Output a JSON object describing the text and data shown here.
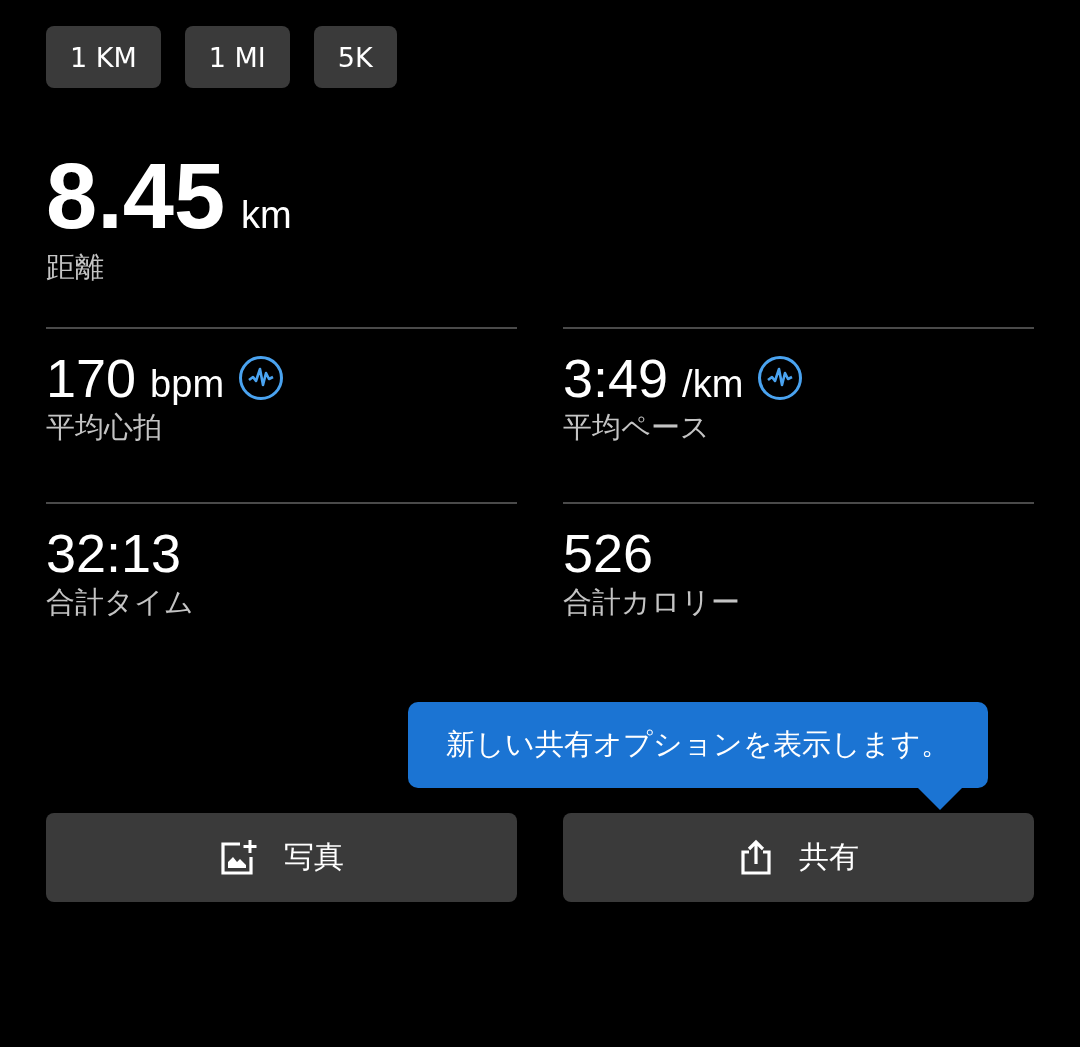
{
  "chips": [
    {
      "label": "1 KM"
    },
    {
      "label": "1 MI"
    },
    {
      "label": "5K"
    }
  ],
  "distance": {
    "value": "8.45",
    "unit": "km",
    "label": "距離"
  },
  "stats": [
    {
      "value": "170",
      "unit": "bpm",
      "label": "平均心拍",
      "chart_icon": true
    },
    {
      "value": "3:49",
      "unit": "/km",
      "label": "平均ペース",
      "chart_icon": true
    },
    {
      "value": "32:13",
      "label": "合計タイム",
      "chart_icon": false
    },
    {
      "value": "526",
      "label": "合計カロリー",
      "chart_icon": false
    }
  ],
  "tooltip": {
    "text": "新しい共有オプションを表示します。"
  },
  "buttons": [
    {
      "kind": "photo",
      "label": "写真"
    },
    {
      "kind": "share",
      "label": "共有"
    }
  ]
}
